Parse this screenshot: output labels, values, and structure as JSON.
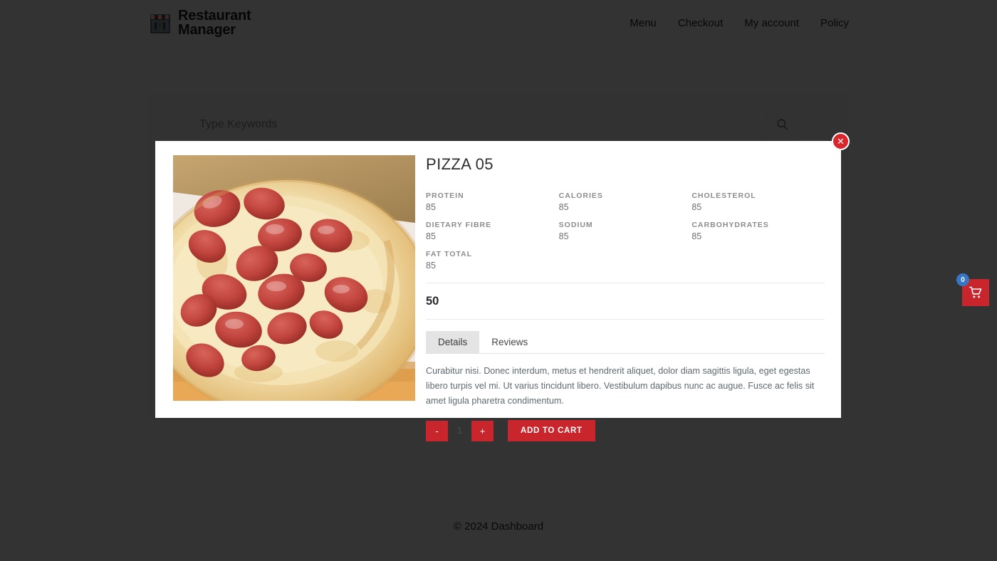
{
  "header": {
    "brand_line1": "Restaurant",
    "brand_line2": "Manager",
    "logo_icon": "storefront-icon",
    "nav": [
      {
        "label": "Menu"
      },
      {
        "label": "Checkout"
      },
      {
        "label": "My account"
      },
      {
        "label": "Policy"
      }
    ]
  },
  "search": {
    "placeholder": "Type Keywords",
    "value": "",
    "icon": "search-icon"
  },
  "cart": {
    "icon": "shopping-cart-icon",
    "count": "0"
  },
  "modal": {
    "close_label": "✕",
    "close_icon": "close-icon",
    "product_image_alt": "pepperoni-pizza",
    "title": "PIZZA 05",
    "nutrition": [
      {
        "label": "PROTEIN",
        "value": "85"
      },
      {
        "label": "CALORIES",
        "value": "85"
      },
      {
        "label": "CHOLESTEROL",
        "value": "85"
      },
      {
        "label": "DIETARY FIBRE",
        "value": "85"
      },
      {
        "label": "SODIUM",
        "value": "85"
      },
      {
        "label": "CARBOHYDRATES",
        "value": "85"
      },
      {
        "label": "FAT TOTAL",
        "value": "85"
      }
    ],
    "price": "50",
    "tabs": [
      {
        "label": "Details",
        "active": true
      },
      {
        "label": "Reviews",
        "active": false
      }
    ],
    "description": "Curabitur nisi. Donec interdum, metus et hendrerit aliquet, dolor diam sagittis ligula, eget egestas libero turpis vel mi. Ut varius tincidunt libero. Vestibulum dapibus nunc ac augue. Fusce ac felis sit amet ligula pharetra condimentum.",
    "qty_decrease": "-",
    "qty_value": "1",
    "qty_increase": "+",
    "add_to_cart": "ADD TO CART"
  },
  "footer": {
    "copyright": "© 2024 Dashboard"
  },
  "colors": {
    "brand_red": "#c9252c",
    "badge_blue": "#3577c4",
    "backdrop": "#333333",
    "tab_active_bg": "#e4e4e4"
  }
}
